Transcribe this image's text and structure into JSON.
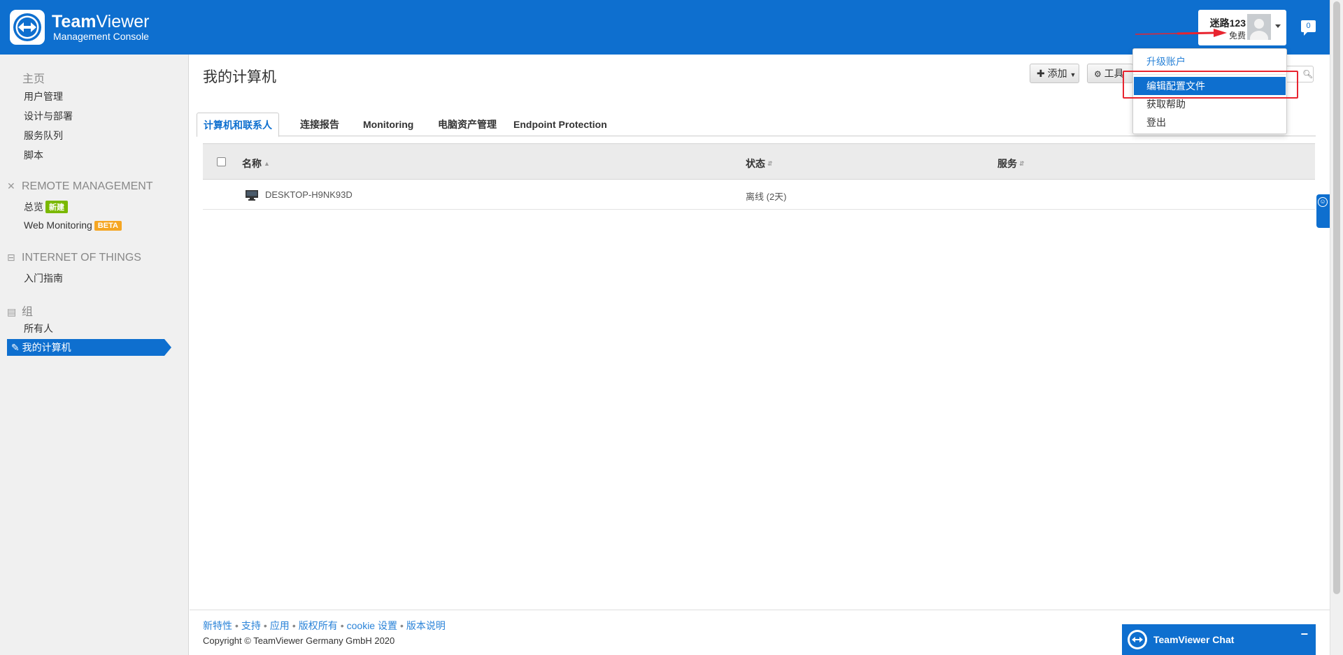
{
  "header": {
    "brand_name_bold": "Team",
    "brand_name_rest": "Viewer",
    "brand_sub": "Management Console",
    "user_name": "迷路123",
    "user_plan": "免费",
    "notifications": "0"
  },
  "user_menu": {
    "upgrade": "升级账户",
    "edit_profile": "编辑配置文件",
    "help": "获取帮助",
    "logout": "登出"
  },
  "sidebar": {
    "home": "主页",
    "home_items": [
      "用户管理",
      "设计与部署",
      "服务队列",
      "脚本"
    ],
    "remote_management": "REMOTE MANAGEMENT",
    "overview": "总览",
    "overview_badge": "新建",
    "web_monitoring": "Web Monitoring",
    "web_monitoring_badge": "BETA",
    "iot": "INTERNET OF THINGS",
    "iot_guide": "入门指南",
    "groups": "组",
    "all_people": "所有人",
    "my_computers": "我的计算机"
  },
  "main": {
    "title": "我的计算机",
    "add_button": "添加",
    "tools_button": "工具",
    "tabs": [
      "计算机和联系人",
      "连接报告",
      "Monitoring",
      "电脑资产管理",
      "Endpoint Protection"
    ],
    "columns": {
      "name": "名称",
      "status": "状态",
      "service": "服务"
    },
    "rows": [
      {
        "name": "DESKTOP-H9NK93D",
        "status": "离线 (2天)"
      }
    ]
  },
  "footer": {
    "links": [
      "新特性",
      "支持",
      "应用",
      "版权所有",
      "cookie 设置",
      "版本说明"
    ],
    "copyright": "Copyright © TeamViewer Germany GmbH 2020"
  },
  "chat": {
    "label": "TeamViewer Chat",
    "minimize": "−"
  },
  "colors": {
    "brand_blue": "#0e6fcf",
    "highlight_red": "#e8242f",
    "badge_new": "#7ab800",
    "badge_beta": "#f5a623"
  }
}
